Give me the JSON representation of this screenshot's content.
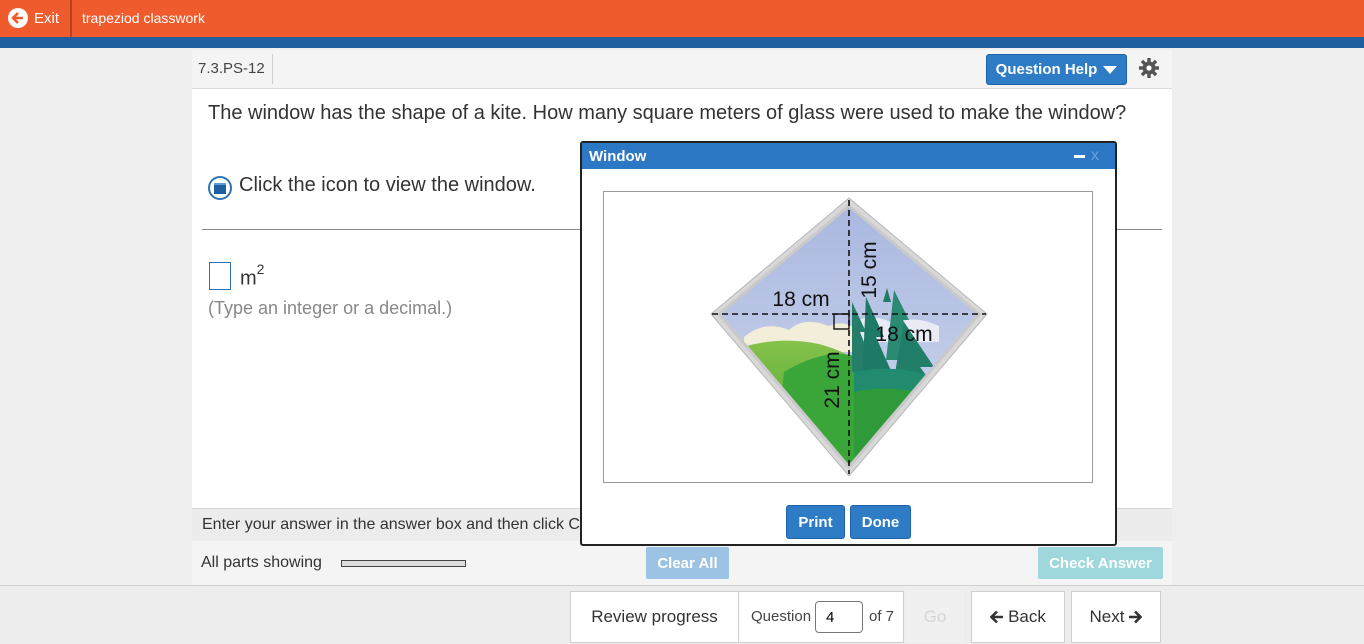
{
  "topbar": {
    "exit_label": "Exit",
    "assignment_title": "trapeziod classwork"
  },
  "question": {
    "id": "7.3.PS-12",
    "help_label": "Question Help",
    "text": "The window has the shape of a kite. How many square meters of glass were used to make the window?",
    "click_instruction": "Click the icon to view the window.",
    "unit": "m",
    "unit_exp": "2",
    "hint": "(Type an integer or a decimal.)",
    "answer_value": ""
  },
  "instructions": "Enter your answer in the answer box and then click Check Answer.",
  "status": {
    "parts_label": "All parts showing",
    "clear_all_label": "Clear All",
    "check_answer_label": "Check Answer"
  },
  "popup": {
    "title": "Window",
    "close_label": "x",
    "print_label": "Print",
    "done_label": "Done",
    "figure_labels": {
      "top_left": "18 cm",
      "top": "15 cm",
      "right": "18 cm",
      "bottom": "21 cm"
    }
  },
  "footer": {
    "review_label": "Review progress",
    "question_label": "Question",
    "question_number": "4",
    "of_label": "of 7",
    "go_label": "Go",
    "back_label": "Back",
    "next_label": "Next"
  },
  "colors": {
    "topbar": "#ef5b2c",
    "stripe": "#1f5fa0",
    "accent_button": "#2e7bc6",
    "clear_all_disabled": "#9cc2e4",
    "check_answer_disabled": "#9fd8dc"
  },
  "icons": [
    "exit-arrow-icon",
    "caret-down-icon",
    "gear-icon",
    "window-icon",
    "minimize-icon",
    "close-icon",
    "back-arrow-icon",
    "next-arrow-icon"
  ]
}
